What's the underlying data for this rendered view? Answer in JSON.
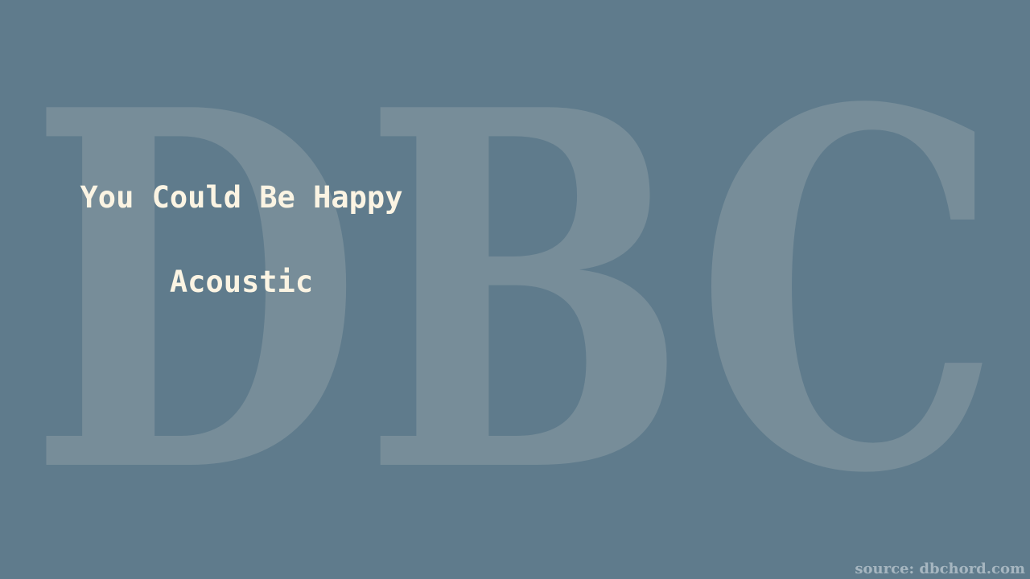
{
  "song": {
    "title": "You Could Be Happy",
    "subtitle": "Acoustic"
  },
  "watermark": {
    "text": "DBC"
  },
  "footer": {
    "source": "source: dbchord.com"
  },
  "colors": {
    "background": "#5f7b8c",
    "watermark": "#778d99",
    "title_text": "#fbf4e3",
    "source_text": "#a6b6c0"
  }
}
